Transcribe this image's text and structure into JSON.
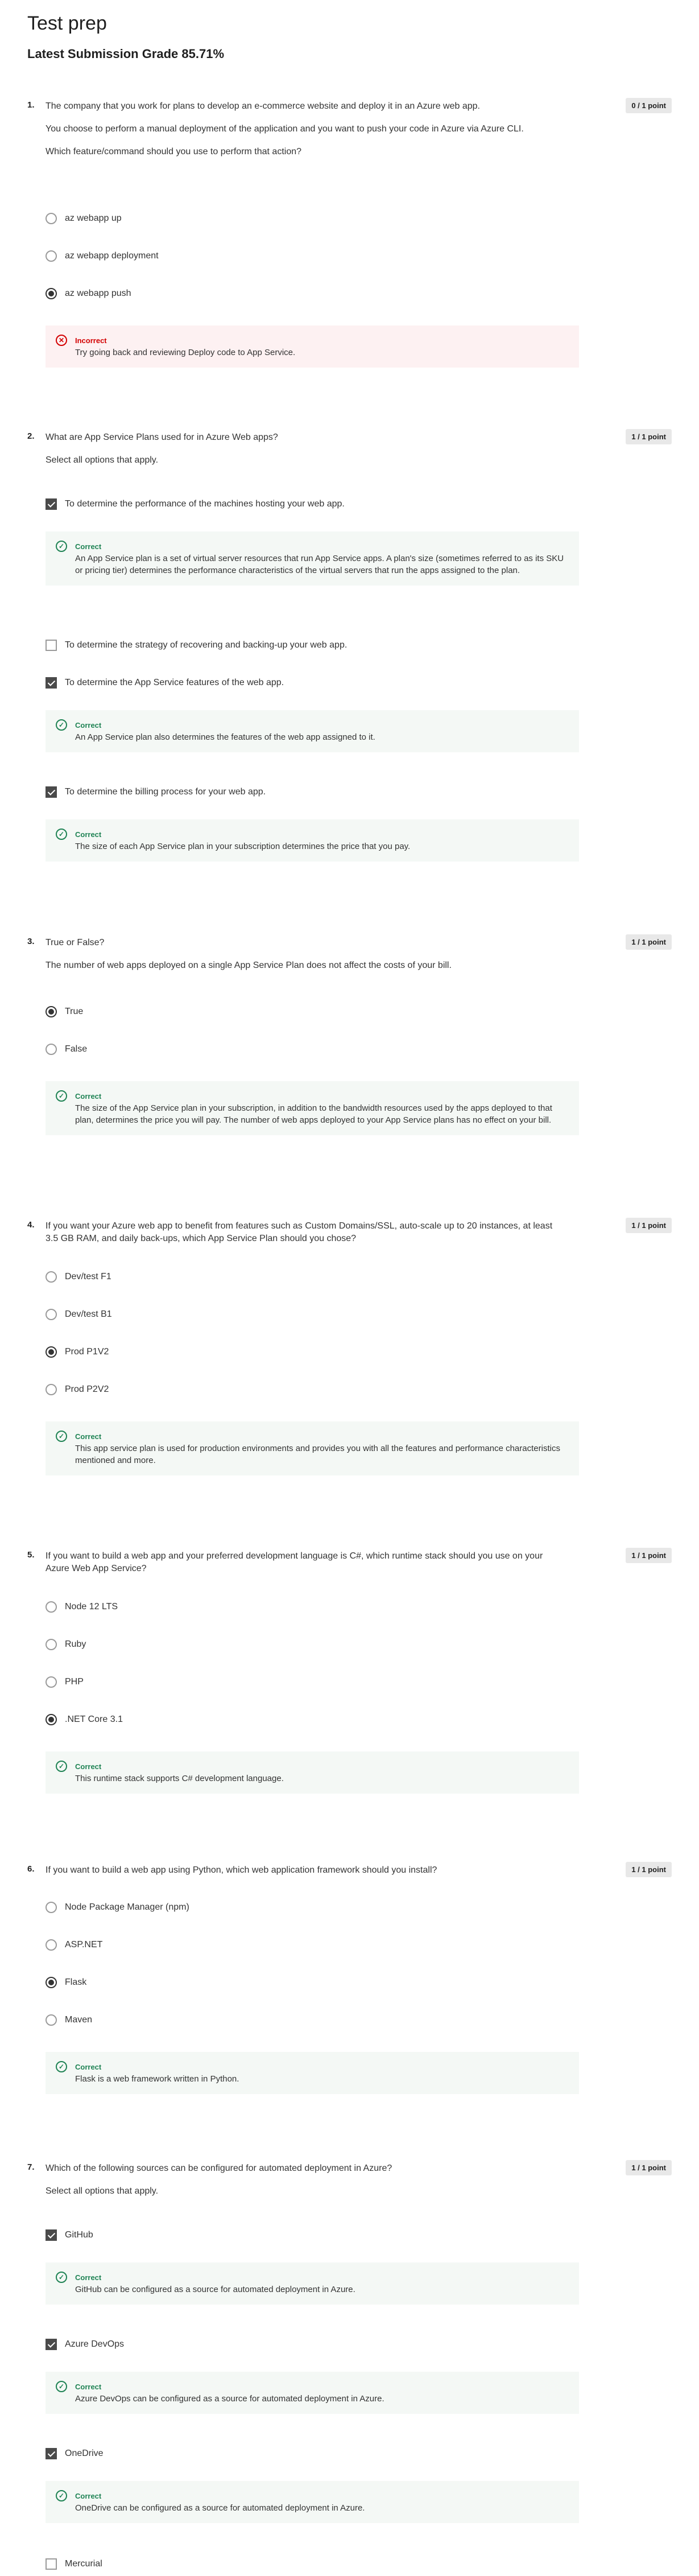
{
  "page": {
    "title": "Test prep",
    "grade": "Latest Submission Grade 85.71%"
  },
  "questions": [
    {
      "num": "1.",
      "score": "0 / 1 point",
      "paragraphs": [
        "The company that you work for plans to develop an e-commerce website and deploy it in an Azure web app.",
        "You choose to perform a manual deployment of the application and you want to push your code in Azure via Azure CLI.",
        "Which feature/command should you use to perform that action?"
      ],
      "options": [
        "az webapp up",
        "az webapp deployment",
        "az webapp push"
      ],
      "feedback": {
        "status": "Incorrect",
        "text": "Try going back and reviewing Deploy code to App Service."
      }
    },
    {
      "num": "2.",
      "score": "1 / 1 point",
      "paragraphs": [
        "What are App Service Plans used for in Azure Web apps?",
        "Select all options that apply."
      ],
      "options": [
        "To determine the performance of the machines hosting your web app.",
        "To determine the strategy of recovering and backing-up your web app.",
        "To determine the App Service features of the web app.",
        "To determine the billing process for your web app."
      ],
      "feedbacks": [
        {
          "status": "Correct",
          "text": "An App Service plan is a set of virtual server resources that run App Service apps. A plan's size (sometimes referred to as its SKU or pricing tier) determines the performance characteristics of the virtual servers that run the apps assigned to the plan."
        },
        {
          "status": "Correct",
          "text": "An App Service plan also determines the features of the web app assigned to it."
        },
        {
          "status": "Correct",
          "text": "The size of each App Service plan in your subscription determines the price that you pay."
        }
      ]
    },
    {
      "num": "3.",
      "score": "1 / 1 point",
      "paragraphs": [
        "True or False?",
        "The number of web apps deployed on a single App Service Plan does not affect the costs of your bill."
      ],
      "options": [
        "True",
        "False"
      ],
      "feedback": {
        "status": "Correct",
        "text": "The size of the App Service plan in your subscription, in addition to the bandwidth resources used by the apps deployed to that plan, determines the price you will pay. The number of web apps deployed to your App Service plans has no effect on your bill."
      }
    },
    {
      "num": "4.",
      "score": "1 / 1 point",
      "paragraphs": [
        "If you want your Azure web app to benefit from features such as Custom Domains/SSL, auto-scale up to 20 instances, at least 3.5 GB RAM, and daily back-ups, which App Service Plan should you chose?"
      ],
      "options": [
        "Dev/test F1",
        "Dev/test B1",
        "Prod P1V2",
        "Prod P2V2"
      ],
      "feedback": {
        "status": "Correct",
        "text": "This app service plan is used for production environments and provides you with all the features and performance characteristics mentioned and more."
      }
    },
    {
      "num": "5.",
      "score": "1 / 1 point",
      "paragraphs": [
        "If you want to build a web app and your preferred development language is C#, which runtime stack should you use on your Azure Web App Service?"
      ],
      "options": [
        "Node 12 LTS",
        "Ruby",
        "PHP",
        ".NET Core 3.1"
      ],
      "feedback": {
        "status": "Correct",
        "text": "This runtime stack supports C# development language."
      }
    },
    {
      "num": "6.",
      "score": "1 / 1 point",
      "paragraphs": [
        "If you want to build a web app using Python, which web application framework should you install?"
      ],
      "options": [
        "Node Package Manager (npm)",
        "ASP.NET",
        "Flask",
        "Maven"
      ],
      "feedback": {
        "status": "Correct",
        "text": "Flask is a web framework written in Python."
      }
    },
    {
      "num": "7.",
      "score": "1 / 1 point",
      "paragraphs": [
        "Which of the following sources can be configured for automated deployment in Azure?",
        "Select all options that apply."
      ],
      "options": [
        "GitHub",
        "Azure DevOps",
        "OneDrive",
        "Mercurial"
      ],
      "feedbacks": [
        {
          "status": "Correct",
          "text": "GitHub can be configured as a source for automated deployment in Azure."
        },
        {
          "status": "Correct",
          "text": "Azure DevOps can be configured as a source for automated deployment in Azure."
        },
        {
          "status": "Correct",
          "text": "OneDrive can be configured as a source for automated deployment in Azure."
        }
      ]
    }
  ]
}
